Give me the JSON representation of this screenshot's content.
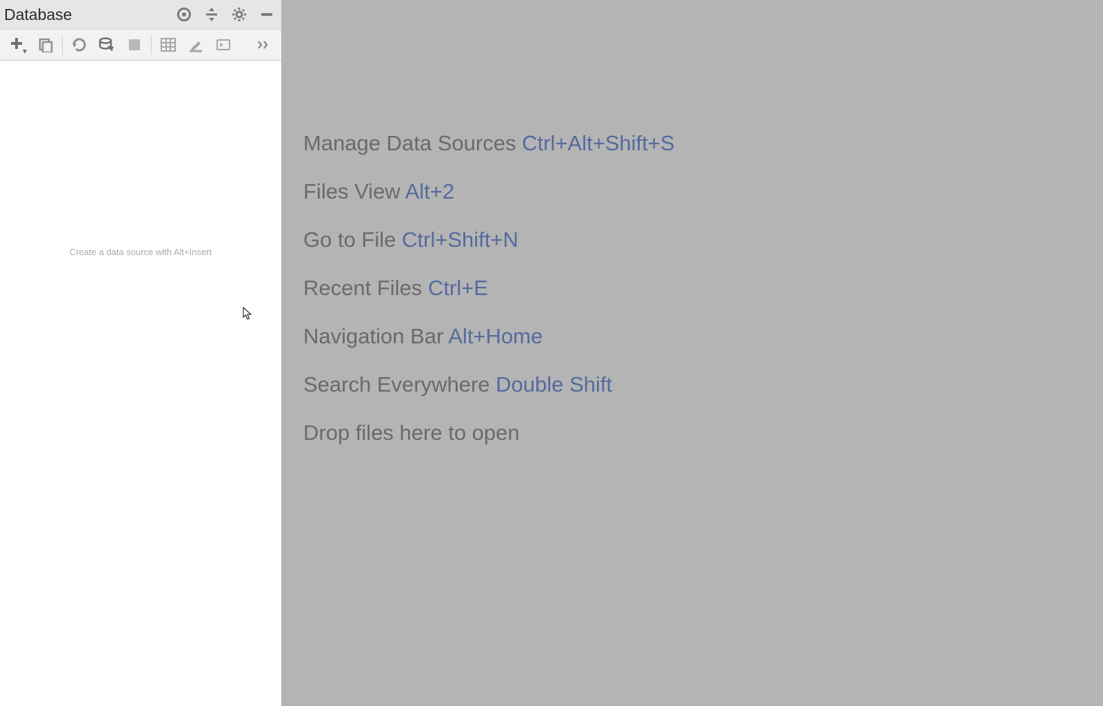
{
  "panel": {
    "title": "Database",
    "placeholder": "Create a data source with Alt+Insert"
  },
  "tips": [
    {
      "label": "Manage Data Sources",
      "shortcut": "Ctrl+Alt+Shift+S"
    },
    {
      "label": "Files View",
      "shortcut": "Alt+2"
    },
    {
      "label": "Go to File",
      "shortcut": "Ctrl+Shift+N"
    },
    {
      "label": "Recent Files",
      "shortcut": "Ctrl+E"
    },
    {
      "label": "Navigation Bar",
      "shortcut": "Alt+Home"
    },
    {
      "label": "Search Everywhere",
      "shortcut": "Double Shift"
    },
    {
      "label": "Drop files here to open",
      "shortcut": ""
    }
  ]
}
